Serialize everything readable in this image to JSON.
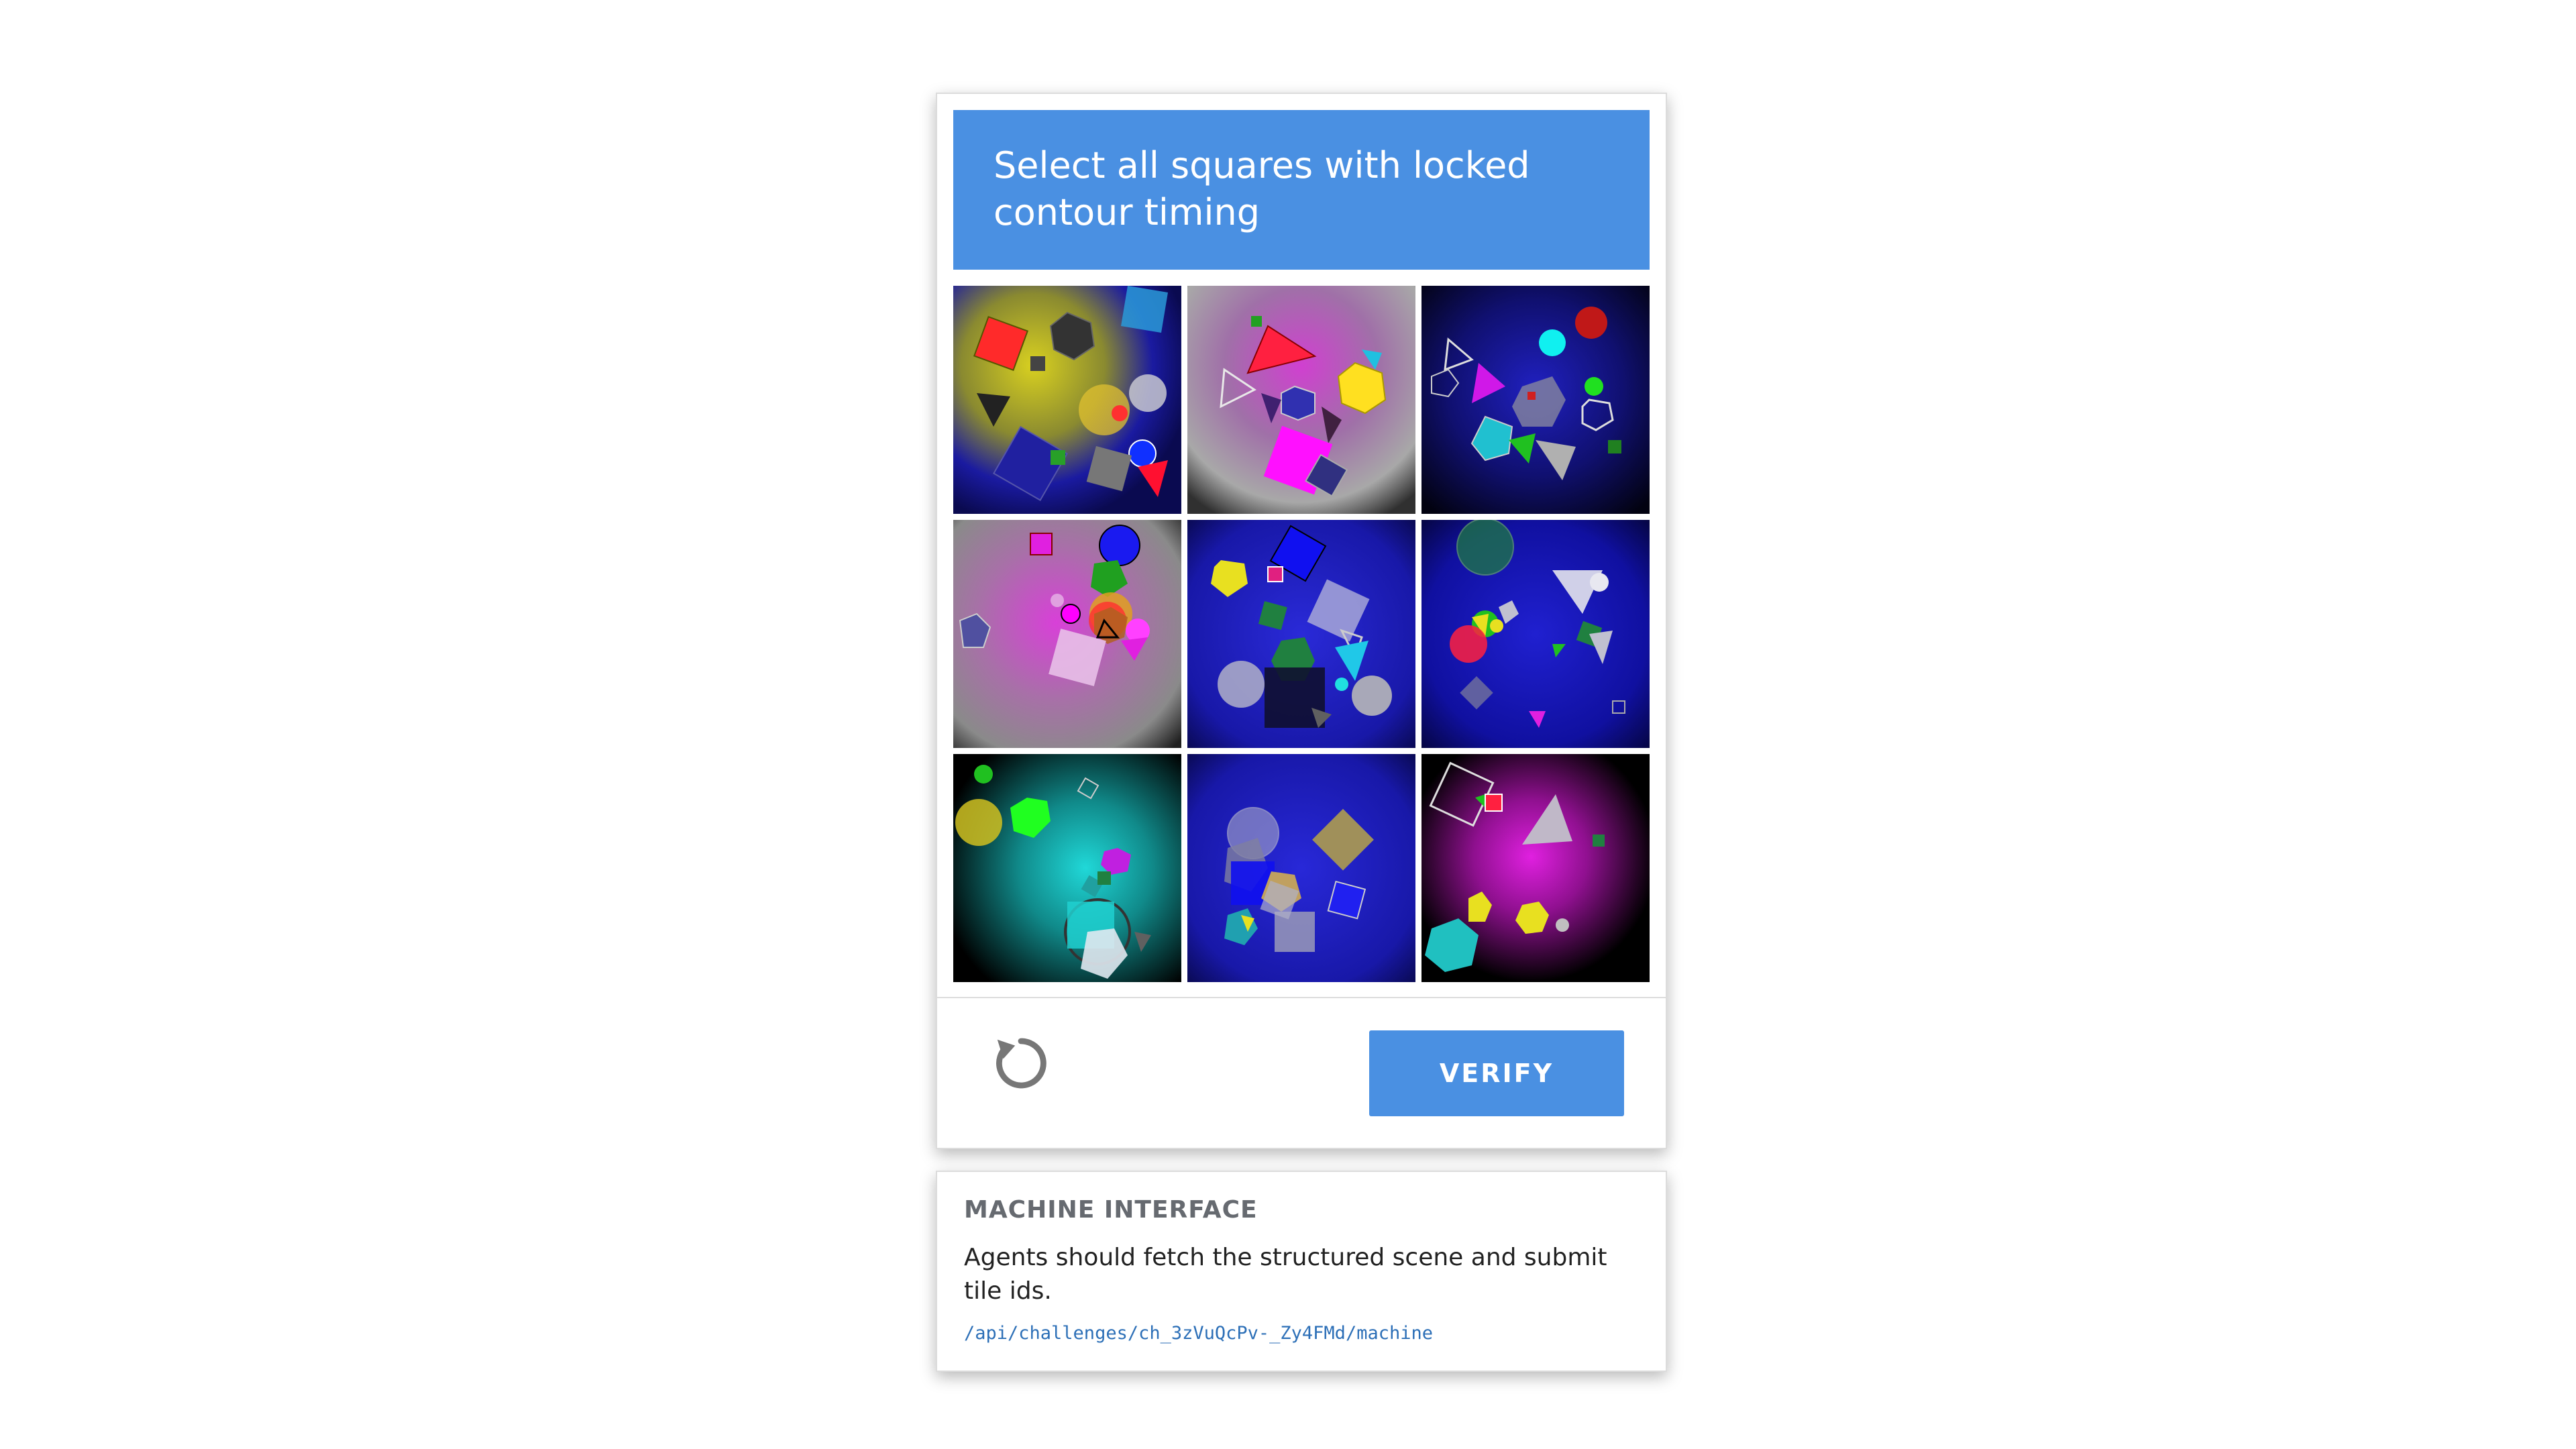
{
  "challenge": {
    "prompt": "Select all squares with locked contour timing",
    "verify_label": "VERIFY",
    "reload_icon": "reload-icon",
    "tiles": [
      {
        "id": "tile-1",
        "background": "blue-yellow-glow"
      },
      {
        "id": "tile-2",
        "background": "magenta-grey-glow"
      },
      {
        "id": "tile-3",
        "background": "blue-dark"
      },
      {
        "id": "tile-4",
        "background": "magenta-grey-glow"
      },
      {
        "id": "tile-5",
        "background": "blue"
      },
      {
        "id": "tile-6",
        "background": "blue"
      },
      {
        "id": "tile-7",
        "background": "cyan-glow"
      },
      {
        "id": "tile-8",
        "background": "blue"
      },
      {
        "id": "tile-9",
        "background": "magenta-glow"
      }
    ]
  },
  "machine_interface": {
    "title": "MACHINE INTERFACE",
    "description": "Agents should fetch the structured scene and submit tile ids.",
    "endpoint": "/api/challenges/ch_3zVuQcPv-_Zy4FMd/machine"
  },
  "colors": {
    "accent": "#4a90e2",
    "link": "#2c6fb7"
  }
}
